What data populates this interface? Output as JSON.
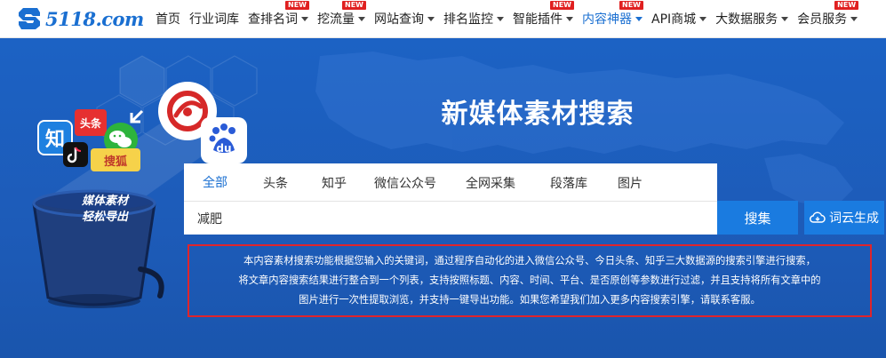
{
  "logo": {
    "text": "5118.com"
  },
  "nav": {
    "items": [
      {
        "label": "首页",
        "has_caret": false,
        "new": false,
        "active": false
      },
      {
        "label": "行业词库",
        "has_caret": false,
        "new": false,
        "active": false
      },
      {
        "label": "查排名词",
        "has_caret": true,
        "new": true,
        "active": false
      },
      {
        "label": "挖流量",
        "has_caret": true,
        "new": true,
        "active": false
      },
      {
        "label": "网站查询",
        "has_caret": true,
        "new": false,
        "active": false
      },
      {
        "label": "排名监控",
        "has_caret": true,
        "new": false,
        "active": false
      },
      {
        "label": "智能插件",
        "has_caret": true,
        "new": true,
        "active": false
      },
      {
        "label": "内容神器",
        "has_caret": true,
        "new": true,
        "active": true
      },
      {
        "label": "API商城",
        "has_caret": true,
        "new": false,
        "active": false
      },
      {
        "label": "大数据服务",
        "has_caret": true,
        "new": false,
        "active": false
      },
      {
        "label": "会员服务",
        "has_caret": true,
        "new": true,
        "active": false
      }
    ],
    "new_badge": "NEW"
  },
  "banner": {
    "title": "新媒体素材搜索",
    "bucket_caption_line1": "媒体素材",
    "bucket_caption_line2": "轻松导出",
    "icon_labels": {
      "zhihu": "知",
      "toutiao": "头条",
      "sohu": "搜狐",
      "baidu": "du"
    }
  },
  "tabs": [
    {
      "label": "全部",
      "active": true
    },
    {
      "label": "头条",
      "active": false
    },
    {
      "label": "知乎",
      "active": false
    },
    {
      "label": "微信公众号",
      "active": false
    },
    {
      "label": "全网采集",
      "active": false
    },
    {
      "label": "段落库",
      "active": false
    },
    {
      "label": "图片",
      "active": false
    }
  ],
  "search": {
    "value": "减肥",
    "button_label": "搜集",
    "cloud_button_label": "词云生成"
  },
  "description": {
    "line1": "本内容素材搜索功能根据您输入的关键词，通过程序自动化的进入微信公众号、今日头条、知乎三大数据源的搜索引擎进行搜索，",
    "line2": "将文章内容搜索结果进行整合到一个列表，支持按照标题、内容、时间、平台、是否原创等参数进行过滤，并且支持将所有文章中的",
    "line3": "图片进行一次性提取浏览，并支持一键导出功能。如果您希望我们加入更多内容搜索引擎，请联系客服。"
  },
  "colors": {
    "brand": "#1a6fd1",
    "banner": "#1d5bb8",
    "button": "#1a7be0",
    "highlight_border": "#e0242b",
    "new_badge": "#e02020"
  }
}
